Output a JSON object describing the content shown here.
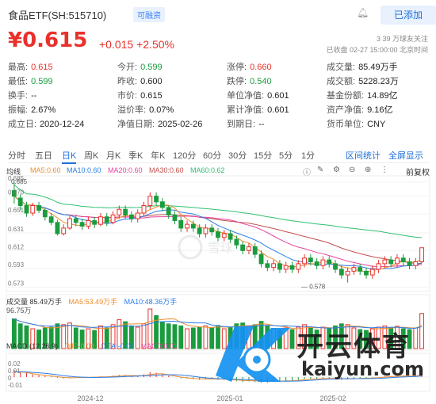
{
  "header": {
    "title": "食品ETF(SH:515710)",
    "badge": "可融资",
    "add_label": "已添加"
  },
  "quote": {
    "price": "¥0.615",
    "change": "+0.015 +2.50%",
    "meta_line1": "3 39 万球友关注",
    "meta_line2": "已收盘 02-27 15:00:00 北京时间"
  },
  "stats": {
    "high": {
      "k": "最高:",
      "v": "0.615"
    },
    "low": {
      "k": "最低:",
      "v": "0.599"
    },
    "turnover": {
      "k": "换手:",
      "v": "--"
    },
    "amplitude": {
      "k": "振幅:",
      "v": "2.67%"
    },
    "founded": {
      "k": "成立日:",
      "v": "2020-12-24"
    },
    "open": {
      "k": "今开:",
      "v": "0.599"
    },
    "prev_close": {
      "k": "昨收:",
      "v": "0.600"
    },
    "market_price": {
      "k": "市价:",
      "v": "0.615"
    },
    "premium": {
      "k": "溢价率:",
      "v": "0.07%"
    },
    "nav_date": {
      "k": "净值日期:",
      "v": "2025-02-26"
    },
    "limit_up": {
      "k": "涨停:",
      "v": "0.660"
    },
    "limit_down": {
      "k": "跌停:",
      "v": "0.540"
    },
    "unit_nav": {
      "k": "单位净值:",
      "v": "0.601"
    },
    "acc_nav": {
      "k": "累计净值:",
      "v": "0.601"
    },
    "expiry": {
      "k": "到期日:",
      "v": "--"
    },
    "volume": {
      "k": "成交量:",
      "v": "85.49万手"
    },
    "amount": {
      "k": "成交额:",
      "v": "5228.23万"
    },
    "fund_share": {
      "k": "基金份额:",
      "v": "14.89亿"
    },
    "net_assets": {
      "k": "资产净值:",
      "v": "9.16亿"
    },
    "currency": {
      "k": "货币单位:",
      "v": "CNY"
    }
  },
  "tabs": [
    "分时",
    "五日",
    "日K",
    "周K",
    "月K",
    "季K",
    "年K",
    "120分",
    "60分",
    "30分",
    "15分",
    "5分",
    "1分"
  ],
  "tab_links": [
    "区间统计",
    "全屏显示"
  ],
  "active_tab": "日K",
  "ma_legend": {
    "label": "均线",
    "ma5": "MA5:0.60",
    "ma10": "MA10:0.60",
    "ma20": "MA20:0.60",
    "ma30": "MA30:0.60",
    "ma60": "MA60:0.62",
    "fq": "前复权"
  },
  "vol_legend": {
    "label": "成交量 85.49万手",
    "ma5": "MA5:53.49万手",
    "ma10": "MA10:48.36万手"
  },
  "macd_legend": {
    "label": "MACD (12,26,9)",
    "dif": "DIF:-0.00",
    "dea": "DEA:-0.00",
    "macd": "MACD:0.01"
  },
  "colors": {
    "up": "#e9312b",
    "down": "#1a9c3e",
    "ma5": "#f08c2e",
    "ma10": "#2b7de9",
    "ma20": "#e9409f",
    "ma30": "#c0504d",
    "ma60": "#2fbf71"
  },
  "watermark": {
    "top": "开云体育",
    "bottom": "kaiyun.com"
  },
  "chart_data": {
    "type": "candlestick",
    "price_axis": [
      "0.685",
      "0.670",
      "0.651",
      "0.631",
      "0.612",
      "0.593",
      "0.573"
    ],
    "high_label": "0.685",
    "low_label": "0.578",
    "volume_axis": [
      "96.75万"
    ],
    "macd_axis": [
      "0.02",
      "0.01",
      "0",
      "-0.01"
    ],
    "x_labels": [
      "2024-12",
      "2025-01",
      "2025-02"
    ],
    "candles": [
      [
        0.676,
        0.67,
        0.685,
        0.662
      ],
      [
        0.668,
        0.66,
        0.672,
        0.655
      ],
      [
        0.66,
        0.652,
        0.664,
        0.648
      ],
      [
        0.652,
        0.66,
        0.663,
        0.649
      ],
      [
        0.66,
        0.655,
        0.664,
        0.652
      ],
      [
        0.655,
        0.648,
        0.658,
        0.644
      ],
      [
        0.648,
        0.642,
        0.652,
        0.639
      ],
      [
        0.642,
        0.63,
        0.645,
        0.628
      ],
      [
        0.63,
        0.636,
        0.64,
        0.628
      ],
      [
        0.636,
        0.646,
        0.65,
        0.634
      ],
      [
        0.646,
        0.642,
        0.65,
        0.638
      ],
      [
        0.642,
        0.638,
        0.646,
        0.634
      ],
      [
        0.638,
        0.644,
        0.648,
        0.635
      ],
      [
        0.644,
        0.64,
        0.648,
        0.636
      ],
      [
        0.64,
        0.648,
        0.652,
        0.638
      ],
      [
        0.648,
        0.642,
        0.652,
        0.638
      ],
      [
        0.642,
        0.65,
        0.654,
        0.64
      ],
      [
        0.65,
        0.656,
        0.66,
        0.646
      ],
      [
        0.656,
        0.65,
        0.66,
        0.646
      ],
      [
        0.65,
        0.646,
        0.654,
        0.642
      ],
      [
        0.646,
        0.652,
        0.656,
        0.642
      ],
      [
        0.652,
        0.66,
        0.664,
        0.648
      ],
      [
        0.66,
        0.67,
        0.674,
        0.656
      ],
      [
        0.67,
        0.664,
        0.674,
        0.66
      ],
      [
        0.664,
        0.658,
        0.668,
        0.654
      ],
      [
        0.658,
        0.65,
        0.66,
        0.646
      ],
      [
        0.65,
        0.644,
        0.654,
        0.64
      ],
      [
        0.644,
        0.636,
        0.648,
        0.632
      ],
      [
        0.636,
        0.64,
        0.644,
        0.632
      ],
      [
        0.64,
        0.636,
        0.644,
        0.632
      ],
      [
        0.636,
        0.63,
        0.64,
        0.626
      ],
      [
        0.63,
        0.636,
        0.64,
        0.626
      ],
      [
        0.636,
        0.632,
        0.64,
        0.628
      ],
      [
        0.632,
        0.626,
        0.636,
        0.622
      ],
      [
        0.626,
        0.63,
        0.634,
        0.622
      ],
      [
        0.63,
        0.624,
        0.634,
        0.62
      ],
      [
        0.624,
        0.618,
        0.628,
        0.614
      ],
      [
        0.618,
        0.612,
        0.622,
        0.608
      ],
      [
        0.612,
        0.616,
        0.62,
        0.608
      ],
      [
        0.616,
        0.608,
        0.62,
        0.604
      ],
      [
        0.608,
        0.598,
        0.612,
        0.594
      ],
      [
        0.598,
        0.594,
        0.602,
        0.59
      ],
      [
        0.594,
        0.598,
        0.602,
        0.59
      ],
      [
        0.598,
        0.592,
        0.602,
        0.588
      ],
      [
        0.592,
        0.596,
        0.6,
        0.588
      ],
      [
        0.596,
        0.592,
        0.6,
        0.588
      ],
      [
        0.592,
        0.598,
        0.602,
        0.588
      ],
      [
        0.598,
        0.604,
        0.608,
        0.594
      ],
      [
        0.604,
        0.6,
        0.608,
        0.596
      ],
      [
        0.6,
        0.596,
        0.604,
        0.592
      ],
      [
        0.596,
        0.602,
        0.606,
        0.592
      ],
      [
        0.602,
        0.598,
        0.606,
        0.594
      ],
      [
        0.598,
        0.592,
        0.602,
        0.588
      ],
      [
        0.592,
        0.586,
        0.596,
        0.582
      ],
      [
        0.586,
        0.59,
        0.594,
        0.578
      ],
      [
        0.59,
        0.594,
        0.598,
        0.586
      ],
      [
        0.594,
        0.59,
        0.598,
        0.586
      ],
      [
        0.59,
        0.586,
        0.594,
        0.582
      ],
      [
        0.586,
        0.592,
        0.596,
        0.582
      ],
      [
        0.592,
        0.598,
        0.602,
        0.588
      ],
      [
        0.598,
        0.602,
        0.606,
        0.594
      ],
      [
        0.602,
        0.598,
        0.606,
        0.594
      ],
      [
        0.598,
        0.604,
        0.608,
        0.594
      ],
      [
        0.604,
        0.6,
        0.608,
        0.596
      ],
      [
        0.6,
        0.596,
        0.604,
        0.592
      ],
      [
        0.596,
        0.6,
        0.604,
        0.592
      ],
      [
        0.6,
        0.615,
        0.615,
        0.599
      ]
    ],
    "volume": [
      72,
      60,
      55,
      48,
      45,
      50,
      52,
      60,
      58,
      62,
      50,
      45,
      48,
      44,
      55,
      50,
      58,
      70,
      65,
      55,
      52,
      60,
      96,
      80,
      65,
      60,
      58,
      55,
      48,
      50,
      52,
      55,
      50,
      56,
      48,
      52,
      60,
      62,
      55,
      58,
      66,
      55,
      48,
      45,
      50,
      46,
      52,
      58,
      50,
      45,
      52,
      48,
      55,
      60,
      58,
      50,
      46,
      44,
      48,
      52,
      55,
      50,
      54,
      48,
      46,
      50,
      85
    ],
    "macd": [
      0.01,
      0.008,
      0.006,
      0.004,
      0.003,
      0.002,
      0.001,
      -0.001,
      -0.002,
      -0.001,
      0.0,
      -0.001,
      0.0,
      0.0,
      0.001,
      0.0,
      0.002,
      0.003,
      0.003,
      0.002,
      0.002,
      0.004,
      0.007,
      0.006,
      0.004,
      0.002,
      0.0,
      -0.002,
      -0.002,
      -0.003,
      -0.004,
      -0.003,
      -0.003,
      -0.004,
      -0.004,
      -0.005,
      -0.006,
      -0.007,
      -0.006,
      -0.007,
      -0.008,
      -0.008,
      -0.007,
      -0.007,
      -0.006,
      -0.006,
      -0.005,
      -0.003,
      -0.003,
      -0.003,
      -0.002,
      -0.002,
      -0.003,
      -0.004,
      -0.003,
      -0.002,
      -0.002,
      -0.002,
      -0.001,
      0.0,
      0.001,
      0.001,
      0.002,
      0.002,
      0.001,
      0.002,
      0.01
    ]
  }
}
